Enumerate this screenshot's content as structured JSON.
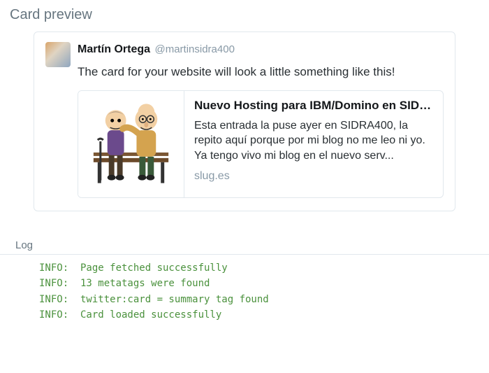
{
  "sections": {
    "preview_title": "Card preview",
    "log_title": "Log"
  },
  "tweet": {
    "display_name": "Martín Ortega",
    "handle": "@martinsidra400",
    "text": "The card for your website will look a little something like this!"
  },
  "link_card": {
    "title": "Nuevo Hosting para IBM/Domino en SID…",
    "description": "Esta entrada la puse ayer en SIDRA400, la repito aquí porque por mi blog no me leo ni yo. Ya tengo vivo mi blog en el nuevo serv...",
    "domain": "slug.es"
  },
  "log": [
    {
      "level": "INFO:",
      "msg": "Page fetched successfully"
    },
    {
      "level": "INFO:",
      "msg": "13 metatags were found"
    },
    {
      "level": "INFO:",
      "msg": "twitter:card = summary tag found"
    },
    {
      "level": "INFO:",
      "msg": "Card loaded successfully"
    }
  ]
}
